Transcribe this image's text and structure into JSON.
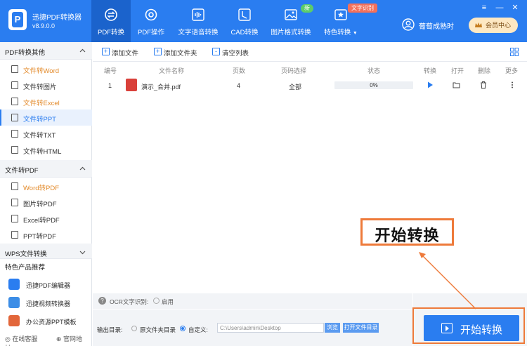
{
  "app": {
    "name": "迅捷PDF转换器",
    "version": "v8.9.0.0",
    "logo_letter": "P"
  },
  "nav": {
    "tabs": [
      {
        "label": "PDF转换",
        "icon": "convert-icon",
        "active": true
      },
      {
        "label": "PDF操作",
        "icon": "gear-icon",
        "active": false
      },
      {
        "label": "文字语音转换",
        "icon": "waveform-icon",
        "active": false
      },
      {
        "label": "CAD转换",
        "icon": "cad-icon",
        "active": false
      },
      {
        "label": "图片格式转换",
        "icon": "image-icon",
        "active": false
      },
      {
        "label": "特色转换",
        "icon": "special-icon",
        "active": false
      }
    ],
    "badge_new": "新",
    "badge_ocr": "文字识别",
    "dropdown_caret": "▼"
  },
  "user": {
    "name": "葡萄成熟时",
    "member_label": "会员中心"
  },
  "window": {
    "menu": "≡",
    "minimize": "—",
    "close": "✕"
  },
  "sidebar": {
    "groups": [
      {
        "title": "PDF转换其他",
        "items": [
          "文件转Word",
          "文件转图片",
          "文件转Excel",
          "文件转PPT",
          "文件转TXT",
          "文件转HTML"
        ]
      },
      {
        "title": "文件转PDF",
        "items": [
          "Word转PDF",
          "图片转PDF",
          "Excel转PDF",
          "PPT转PDF"
        ]
      },
      {
        "title": "WPS文件转换",
        "items": []
      }
    ],
    "active_item": "文件转PPT",
    "featured_title": "特色产品推荐",
    "featured": [
      "迅捷PDF编辑器",
      "迅捷视频转换器",
      "办公资源PPT模板"
    ],
    "bottom": {
      "service": "在线客服",
      "website": "官网地址"
    }
  },
  "toolbar": {
    "add_file": "添加文件",
    "add_folder": "添加文件夹",
    "clear_list": "清空列表"
  },
  "table": {
    "headers": [
      "编号",
      "文件名称",
      "页数",
      "页码选择",
      "状态",
      "转换",
      "打开",
      "删除",
      "更多"
    ],
    "rows": [
      {
        "index": "1",
        "filename": "演示_合并.pdf",
        "pages": "4",
        "page_select": "全部",
        "progress": 0,
        "status": "0%"
      }
    ]
  },
  "ocr": {
    "label": "OCR文字识别:",
    "enable": "启用"
  },
  "output": {
    "label": "输出目录:",
    "option_original": "原文件夹目录",
    "option_custom": "自定义:",
    "path": "C:\\Users\\admin\\Desktop",
    "browse": "浏览",
    "open_folder": "打开文件目录"
  },
  "start_button": "开始转换",
  "callout_text": "开始转换",
  "colors": {
    "primary": "#2a7df0",
    "highlight": "#ee7a3a",
    "accent_orange": "#e38a2a"
  }
}
